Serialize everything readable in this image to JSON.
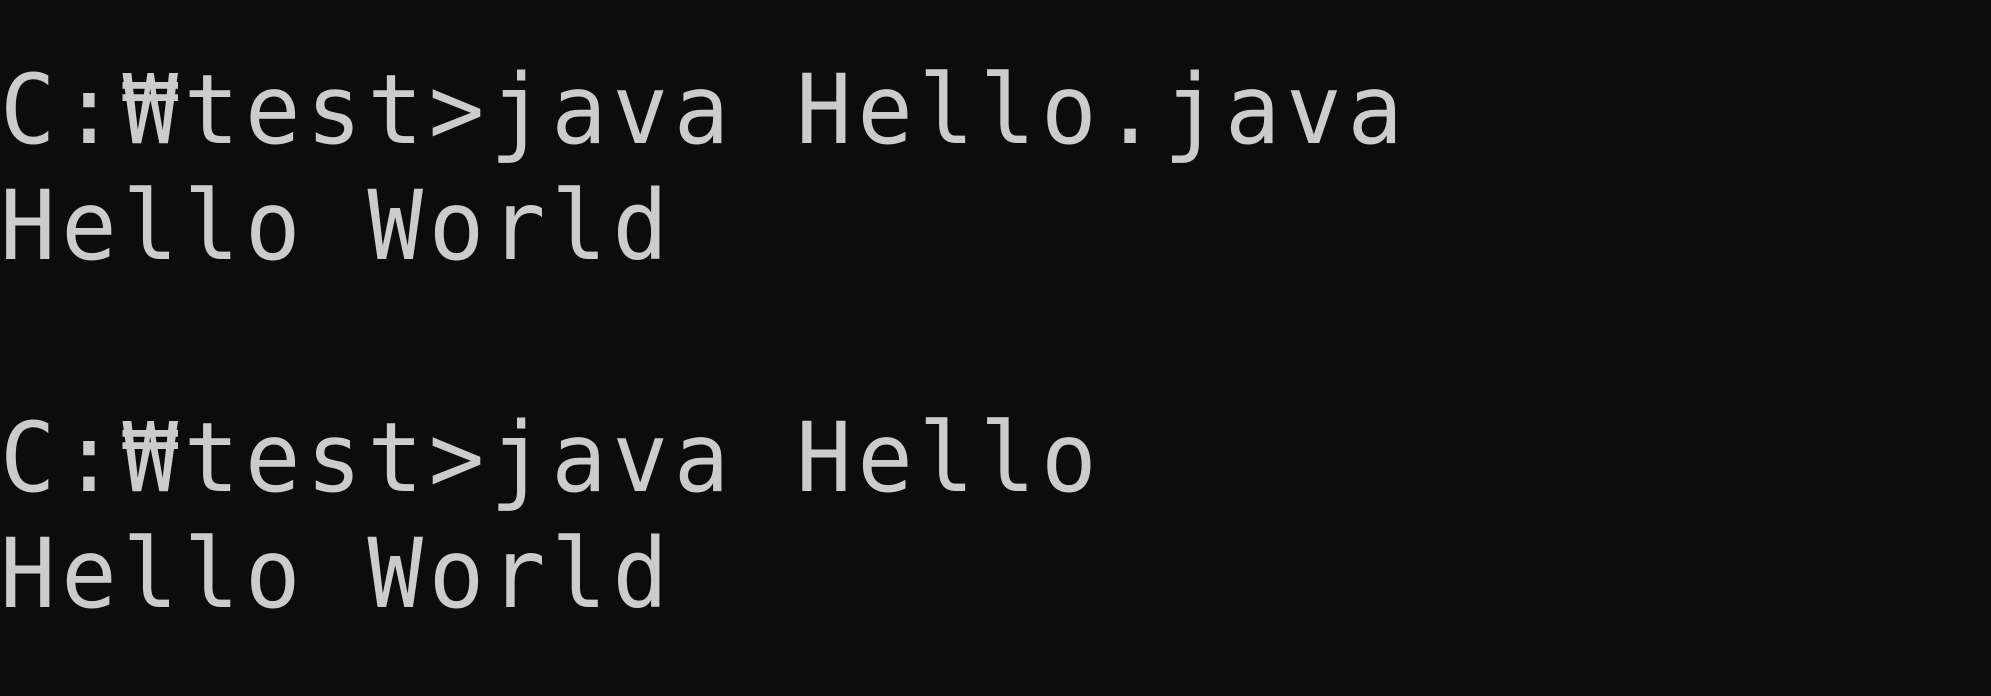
{
  "terminal": {
    "lines": [
      "C:₩test>java Hello.java",
      "Hello World",
      "",
      "C:₩test>java Hello",
      "Hello World"
    ]
  }
}
